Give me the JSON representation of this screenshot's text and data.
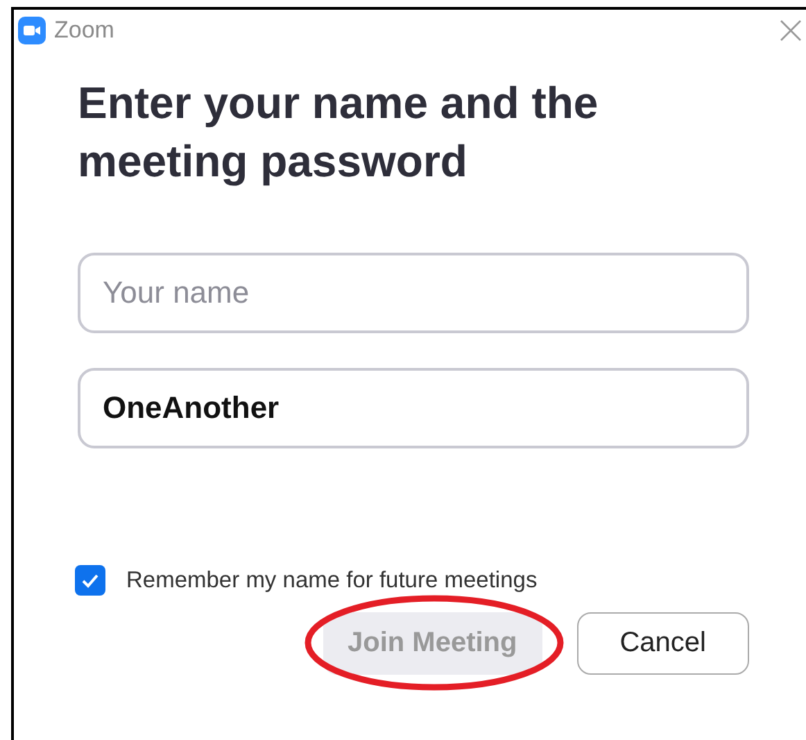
{
  "window": {
    "title": "Zoom"
  },
  "heading": "Enter your name and the meeting password",
  "fields": [
    {
      "placeholder": "Your name"
    },
    {
      "value": "OneAnother"
    }
  ],
  "remember": {
    "label": "Remember my name for future meetings",
    "checked": true
  },
  "buttons": [
    {
      "label": "Join Meeting",
      "disabled": true,
      "circled": true
    },
    {
      "label": "Cancel",
      "disabled": false,
      "circled": false
    }
  ]
}
